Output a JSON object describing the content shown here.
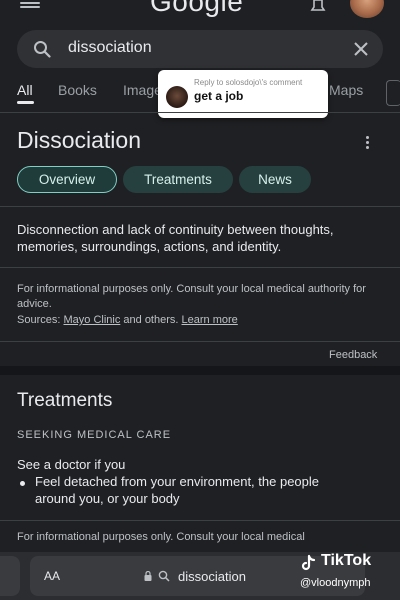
{
  "header": {
    "logo": "Google"
  },
  "search": {
    "query": "dissociation"
  },
  "tabs": [
    {
      "label": "All"
    },
    {
      "label": "Books"
    },
    {
      "label": "Images"
    },
    {
      "label": "Maps"
    }
  ],
  "comment": {
    "caption": "Reply to solosdojo\\'s comment",
    "text": "get a job"
  },
  "panel": {
    "title": "Dissociation",
    "chips": [
      {
        "label": "Overview"
      },
      {
        "label": "Treatments"
      },
      {
        "label": "News"
      }
    ],
    "definition": "Disconnection and lack of continuity between thoughts, memories, surroundings, actions, and identity.",
    "disclaimer": "For informational purposes only. Consult your local medical authority for advice.",
    "sources_prefix": "Sources:",
    "sources_link": "Mayo Clinic",
    "sources_middle": "and others.",
    "learn_more": "Learn more",
    "feedback": "Feedback"
  },
  "treatments": {
    "title": "Treatments",
    "subheading": "SEEKING MEDICAL CARE",
    "intro": "See a doctor if you",
    "bullet": "Feel detached from your environment, the people around you, or your body",
    "disclaimer": "For informational purposes only. Consult your local medical"
  },
  "bottom_bar": {
    "text_size": "AA",
    "url": "dissociation"
  },
  "watermark": {
    "brand": "TikTok",
    "user": "@vloodnymph"
  },
  "colors": {
    "background": "#1f2023",
    "chip_accent": "#7fcfc4"
  }
}
